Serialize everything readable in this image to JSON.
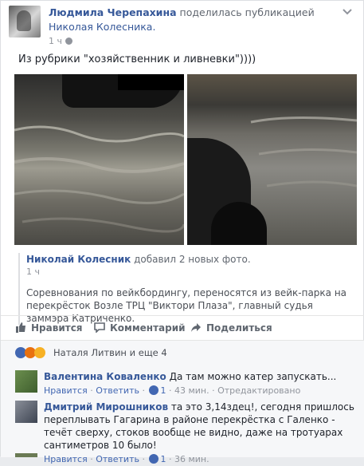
{
  "post": {
    "author": "Людмила Черепахина",
    "verb": "поделилась публикацией",
    "shared_from": "Николая Колесника.",
    "time": "1 ч",
    "text": "Из рубрики \"хозяйственник и ливневки\"))))"
  },
  "shared": {
    "author": "Николай Колесник",
    "verb": "добавил 2 новых фото.",
    "time": "1 ч",
    "text": "Соревнования по вейкбордингу, переносятся из вейк-парка на перекрёсток Возле ТРЦ \"Виктори Плаза\", главный судья заммэра Катриченко."
  },
  "actions": {
    "like": "Нравится",
    "comment": "Комментарий",
    "share": "Поделиться"
  },
  "reactions": {
    "names": "Наталя Литвин и еще 4"
  },
  "comments": [
    {
      "author": "Валентина Коваленко",
      "text": "Да там можно катер запускать...",
      "like": "Нравится",
      "reply": "Ответить",
      "likes": "1",
      "time": "43 мин.",
      "extra": "Отредактировано",
      "sep": "·"
    },
    {
      "author": "Дмитрий Мирошников",
      "text": "та это 3,14здец!, сегодня пришлось переплывать Гагарина в районе перекрёстка с Галенко - течёт сверху, стоков вообще не видно, даже на тротуарах сантиметров 10 было!",
      "like": "Нравится",
      "reply": "Ответить",
      "likes": "1",
      "time": "36 мин.",
      "sep": "·"
    }
  ],
  "colors": {
    "link": "#365899",
    "like_blue": "#4267b2"
  }
}
